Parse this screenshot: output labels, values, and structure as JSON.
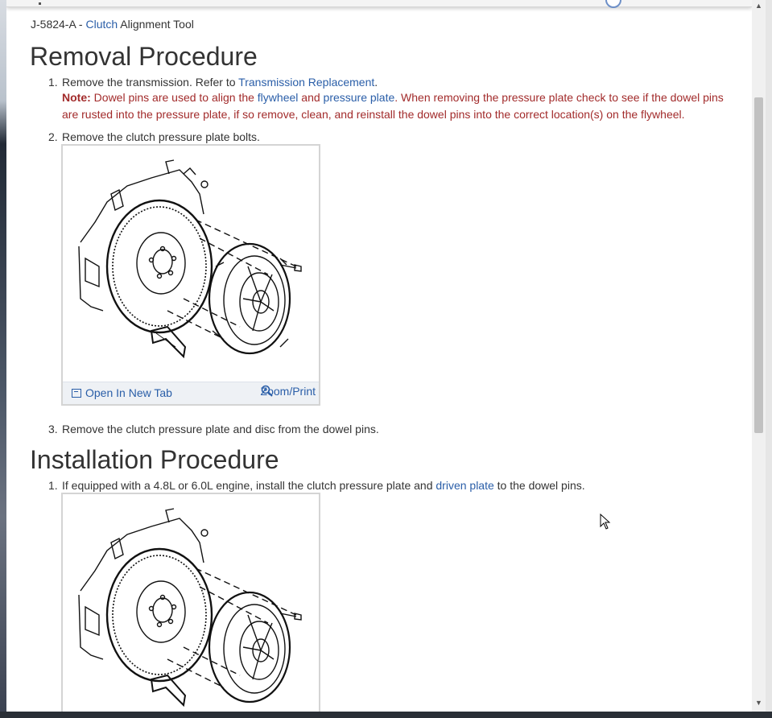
{
  "tool_line": {
    "part_number": "J-5824-A - ",
    "link": "Clutch",
    "rest": " Alignment Tool"
  },
  "removal": {
    "heading": "Removal Procedure",
    "steps": [
      {
        "num": "1.",
        "text_a": "Remove the transmission. Refer to ",
        "link": "Transmission Replacement",
        "text_b": "."
      },
      {
        "num": "2.",
        "text": "Remove the clutch pressure plate bolts."
      },
      {
        "num": "3.",
        "text": "Remove the clutch pressure plate and disc from the dowel pins."
      }
    ],
    "note": {
      "label": "Note:",
      "text_a": " Dowel pins are used to align the ",
      "link_a": "flywheel",
      "text_b": " and ",
      "link_b": "pressure plate",
      "text_c": ". When removing the pressure plate check to see if the dowel pins are rusted into the pressure plate, if so remove, clean, and reinstall the dowel pins into the correct location(s) on the flywheel."
    }
  },
  "figure": {
    "open_label": "Open In New Tab",
    "zoom_label": "Zoom/Print",
    "open_icon": "open-new-tab-icon",
    "zoom_icon": "magnifier-plus-icon"
  },
  "install": {
    "heading": "Installation Procedure",
    "steps": [
      {
        "num": "1.",
        "text_a": "If equipped with a 4.8L or 6.0L engine, install the clutch pressure plate and ",
        "link": "driven plate",
        "text_b": " to the dowel pins."
      }
    ]
  },
  "colors": {
    "link": "#2a5ea8",
    "note": "#a22b2b",
    "text": "#333333"
  }
}
